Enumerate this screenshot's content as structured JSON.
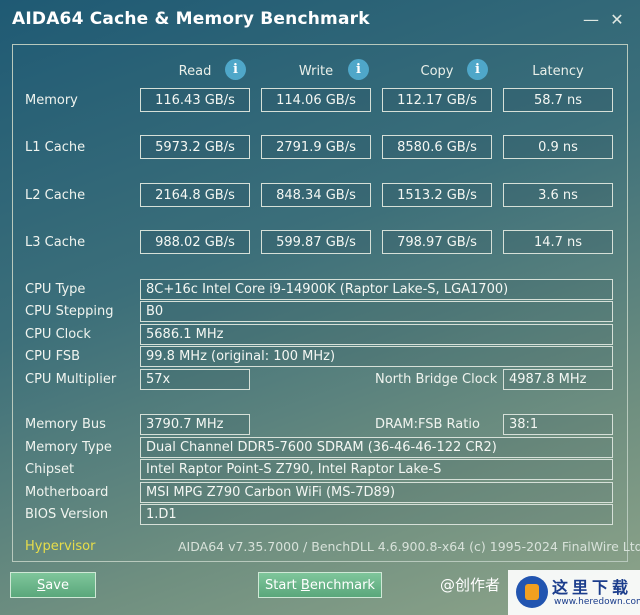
{
  "window": {
    "title": "AIDA64 Cache & Memory Benchmark",
    "minimize_glyph": "—",
    "close_glyph": "✕"
  },
  "columns": {
    "read": "Read",
    "write": "Write",
    "copy": "Copy",
    "latency": "Latency",
    "info_glyph": "i"
  },
  "bench_rows": [
    {
      "label": "Memory",
      "read": "116.43 GB/s",
      "write": "114.06 GB/s",
      "copy": "112.17 GB/s",
      "latency": "58.7 ns"
    },
    {
      "label": "L1 Cache",
      "read": "5973.2 GB/s",
      "write": "2791.9 GB/s",
      "copy": "8580.6 GB/s",
      "latency": "0.9 ns"
    },
    {
      "label": "L2 Cache",
      "read": "2164.8 GB/s",
      "write": "848.34 GB/s",
      "copy": "1513.2 GB/s",
      "latency": "3.6 ns"
    },
    {
      "label": "L3 Cache",
      "read": "988.02 GB/s",
      "write": "599.87 GB/s",
      "copy": "798.97 GB/s",
      "latency": "14.7 ns"
    }
  ],
  "cpu": {
    "type_label": "CPU Type",
    "type_value": "8C+16c Intel Core i9-14900K  (Raptor Lake-S, LGA1700)",
    "stepping_label": "CPU Stepping",
    "stepping_value": "B0",
    "clock_label": "CPU Clock",
    "clock_value": "5686.1 MHz",
    "fsb_label": "CPU FSB",
    "fsb_value": "99.8 MHz  (original: 100 MHz)",
    "multiplier_label": "CPU Multiplier",
    "multiplier_value": "57x",
    "nb_clock_label": "North Bridge Clock",
    "nb_clock_value": "4987.8 MHz"
  },
  "memory": {
    "bus_label": "Memory Bus",
    "bus_value": "3790.7 MHz",
    "ratio_label": "DRAM:FSB Ratio",
    "ratio_value": "38:1",
    "type_label": "Memory Type",
    "type_value": "Dual Channel DDR5-7600 SDRAM  (36-46-46-122 CR2)",
    "chipset_label": "Chipset",
    "chipset_value": "Intel Raptor Point-S Z790, Intel Raptor Lake-S",
    "motherboard_label": "Motherboard",
    "motherboard_value": "MSI MPG Z790 Carbon WiFi (MS-7D89)",
    "bios_label": "BIOS Version",
    "bios_value": "1.D1"
  },
  "footer": {
    "hypervisor": "Hypervisor",
    "version": "AIDA64 v7.35.7000 / BenchDLL 4.6.900.8-x64  (c) 1995-2024 FinalWire Ltd."
  },
  "buttons": {
    "save_first": "S",
    "save_rest": "ave",
    "start_prefix": "Start ",
    "start_underlined": "B",
    "start_rest": "enchmark"
  },
  "watermark": {
    "text": "@创作者",
    "logo_text": "这里下载",
    "logo_url": "www.heredown.com"
  },
  "colors": {
    "hypervisor": "#e7dd4a",
    "button": "#6bb78a",
    "info_icon": "#4fa7c9"
  }
}
